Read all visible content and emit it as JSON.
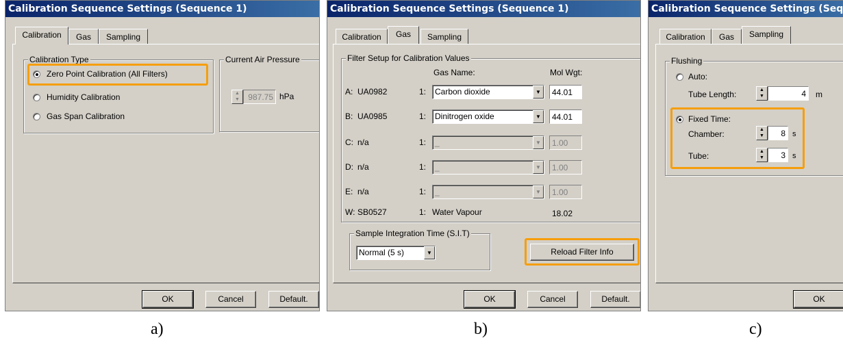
{
  "window_title": "Calibration Sequence Settings (Sequence 1)",
  "window_title_cut": "Calibration Sequence Settings (Sequence",
  "tabs": [
    "Calibration",
    "Gas",
    "Sampling"
  ],
  "buttons": {
    "ok": "OK",
    "cancel": "Cancel",
    "default": "Default."
  },
  "captions": {
    "a": "a)",
    "b": "b)",
    "c": "c)"
  },
  "highlight_color": "#f59e0b",
  "panel_a": {
    "calibration_type_label": "Calibration Type",
    "options": [
      "Zero Point Calibration (All Filters)",
      "Humidity Calibration",
      "Gas Span Calibration"
    ],
    "selected_option": "Zero Point Calibration (All Filters)",
    "pressure_label": "Current Air Pressure",
    "pressure_value": "987.75",
    "pressure_unit": "hPa"
  },
  "panel_b": {
    "filter_group_label": "Filter Setup for Calibration Values",
    "col_gas_name": "Gas Name:",
    "col_mol_wgt": "Mol Wgt:",
    "rows": [
      {
        "channel": "A:",
        "filter": "UA0982",
        "idx": "1:",
        "gas": "Carbon dioxide",
        "mol": "44.01",
        "enabled": true
      },
      {
        "channel": "B:",
        "filter": "UA0985",
        "idx": "1:",
        "gas": "Dinitrogen oxide",
        "mol": "44.01",
        "enabled": true
      },
      {
        "channel": "C:",
        "filter": "n/a",
        "idx": "1:",
        "gas": "_",
        "mol": "1.00",
        "enabled": false
      },
      {
        "channel": "D:",
        "filter": "n/a",
        "idx": "1:",
        "gas": "_",
        "mol": "1.00",
        "enabled": false
      },
      {
        "channel": "E:",
        "filter": "n/a",
        "idx": "1:",
        "gas": "_",
        "mol": "1.00",
        "enabled": false
      }
    ],
    "water": {
      "channel": "W:",
      "filter": "SB0527",
      "idx": "1:",
      "gas": "Water Vapour",
      "mol": "18.02"
    },
    "sit_label": "Sample Integration Time (S.I.T)",
    "sit_value": "Normal (5 s)",
    "reload_button": "Reload Filter Info"
  },
  "panel_c": {
    "flushing_label": "Flushing",
    "auto_label": "Auto:",
    "tube_length_label": "Tube Length:",
    "tube_length_value": "4",
    "tube_length_unit": "m",
    "fixed_time_label": "Fixed Time:",
    "chamber_label": "Chamber:",
    "chamber_value": "8",
    "tube_label": "Tube:",
    "tube_value": "3",
    "seconds_unit": "s",
    "selected_mode": "Fixed Time"
  }
}
